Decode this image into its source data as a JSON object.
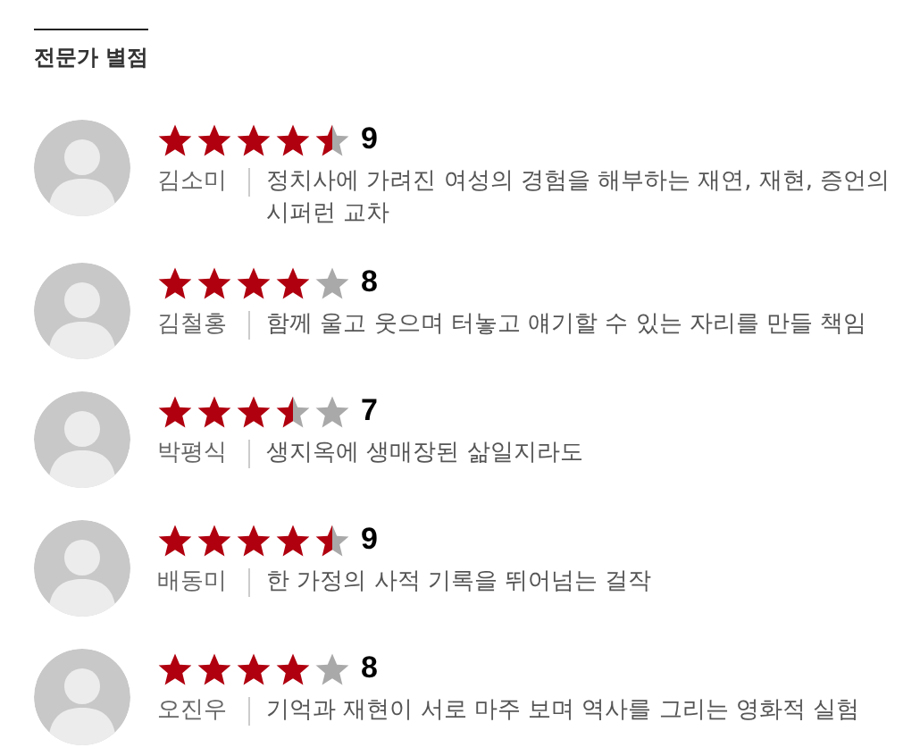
{
  "section": {
    "title": "전문가 별점"
  },
  "reviews": [
    {
      "stars": 4.5,
      "score": "9",
      "name": "김소미",
      "comment": "정치사에 가려진 여성의 경험을 해부하는 재연, 재현, 증언의 시퍼런 교차"
    },
    {
      "stars": 4,
      "score": "8",
      "name": "김철홍",
      "comment": "함께 울고 웃으며 터놓고 얘기할 수 있는 자리를 만들 책임"
    },
    {
      "stars": 3.5,
      "score": "7",
      "name": "박평식",
      "comment": "생지옥에 생매장된 삶일지라도"
    },
    {
      "stars": 4.5,
      "score": "9",
      "name": "배동미",
      "comment": "한 가정의 사적 기록을 뛰어넘는 걸작"
    },
    {
      "stars": 4,
      "score": "8",
      "name": "오진우",
      "comment": "기억과 재현이 서로 마주 보며 역사를 그리는 영화적 실험"
    }
  ]
}
